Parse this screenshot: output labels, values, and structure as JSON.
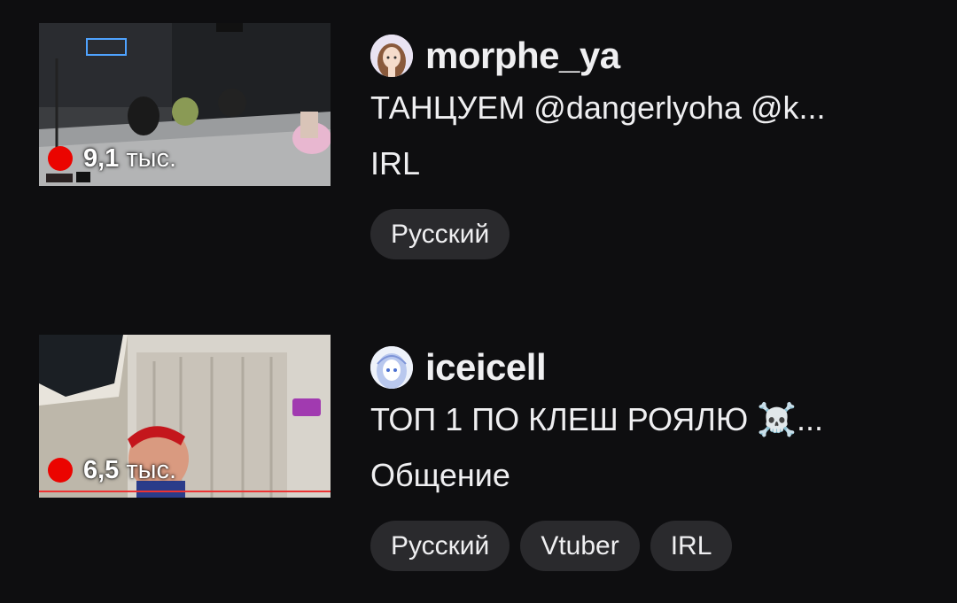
{
  "streams": [
    {
      "channel": "morphe_ya",
      "title": "ТАНЦУЕМ @dangerlyoha @k...",
      "category": "IRL",
      "viewers_num": "9,1",
      "viewers_unit": " тыс.",
      "tags": [
        "Русский"
      ],
      "avatar_icon": "anime-girl-avatar",
      "thumbnail_icon": "dance-studio-thumbnail"
    },
    {
      "channel": "iceicell",
      "title": "ТОП 1 ПО КЛЕШ РОЯЛЮ ☠️...",
      "category": "Общение",
      "viewers_num": "6,5",
      "viewers_unit": " тыс.",
      "tags": [
        "Русский",
        "Vtuber",
        "IRL"
      ],
      "avatar_icon": "anime-avatar-blue",
      "thumbnail_icon": "room-streamer-thumbnail"
    }
  ],
  "colors": {
    "background": "#0e0e10",
    "live_red": "#eb0400",
    "tag_bg": "#2a2a2d",
    "text": "#efeff1"
  }
}
